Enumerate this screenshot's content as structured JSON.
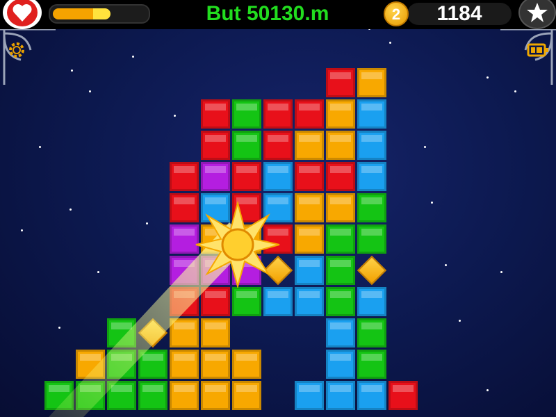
{
  "hud": {
    "goal_text": "But 50130.m",
    "coin_count": "2",
    "score": "1184",
    "energy_fraction": 0.62
  },
  "icons": {
    "lives": "heart-icon",
    "favorite": "star-icon",
    "settings": "gear-icon",
    "battery": "battery-icon",
    "burst": "starburst-icon"
  },
  "colors": {
    "red": "#e8101a",
    "green": "#14c414",
    "blue": "#1aa0f0",
    "orange": "#f8a800",
    "purple": "#b41ee0",
    "goal_text": "#22dd1f"
  },
  "board": {
    "blocks": [
      {
        "c": "red",
        "col": 9,
        "row": 0
      },
      {
        "c": "orange",
        "col": 10,
        "row": 0
      },
      {
        "c": "red",
        "col": 5,
        "row": 1
      },
      {
        "c": "green",
        "col": 6,
        "row": 1
      },
      {
        "c": "red",
        "col": 7,
        "row": 1
      },
      {
        "c": "red",
        "col": 8,
        "row": 1
      },
      {
        "c": "orange",
        "col": 9,
        "row": 1
      },
      {
        "c": "blue",
        "col": 10,
        "row": 1
      },
      {
        "c": "red",
        "col": 5,
        "row": 2
      },
      {
        "c": "green",
        "col": 6,
        "row": 2
      },
      {
        "c": "red",
        "col": 7,
        "row": 2
      },
      {
        "c": "orange",
        "col": 8,
        "row": 2
      },
      {
        "c": "orange",
        "col": 9,
        "row": 2
      },
      {
        "c": "blue",
        "col": 10,
        "row": 2
      },
      {
        "c": "red",
        "col": 4,
        "row": 3
      },
      {
        "c": "purple",
        "col": 5,
        "row": 3
      },
      {
        "c": "red",
        "col": 6,
        "row": 3
      },
      {
        "c": "blue",
        "col": 7,
        "row": 3
      },
      {
        "c": "red",
        "col": 8,
        "row": 3
      },
      {
        "c": "red",
        "col": 9,
        "row": 3
      },
      {
        "c": "blue",
        "col": 10,
        "row": 3
      },
      {
        "c": "red",
        "col": 4,
        "row": 4
      },
      {
        "c": "blue",
        "col": 5,
        "row": 4
      },
      {
        "c": "red",
        "col": 6,
        "row": 4
      },
      {
        "c": "blue",
        "col": 7,
        "row": 4
      },
      {
        "c": "orange",
        "col": 8,
        "row": 4
      },
      {
        "c": "orange",
        "col": 9,
        "row": 4
      },
      {
        "c": "green",
        "col": 10,
        "row": 4
      },
      {
        "c": "purple",
        "col": 4,
        "row": 5
      },
      {
        "c": "orange",
        "col": 5,
        "row": 5
      },
      {
        "c": "orange",
        "col": 6,
        "row": 5
      },
      {
        "c": "red",
        "col": 7,
        "row": 5
      },
      {
        "c": "orange",
        "col": 8,
        "row": 5
      },
      {
        "c": "green",
        "col": 9,
        "row": 5
      },
      {
        "c": "green",
        "col": 10,
        "row": 5
      },
      {
        "c": "purple",
        "col": 4,
        "row": 6
      },
      {
        "c": "purple",
        "col": 5,
        "row": 6
      },
      {
        "c": "purple",
        "col": 6,
        "row": 6
      },
      {
        "c": "blue",
        "col": 8,
        "row": 6
      },
      {
        "c": "green",
        "col": 9,
        "row": 6
      },
      {
        "c": "red",
        "col": 4,
        "row": 7
      },
      {
        "c": "red",
        "col": 5,
        "row": 7
      },
      {
        "c": "green",
        "col": 6,
        "row": 7
      },
      {
        "c": "blue",
        "col": 7,
        "row": 7
      },
      {
        "c": "blue",
        "col": 8,
        "row": 7
      },
      {
        "c": "green",
        "col": 9,
        "row": 7
      },
      {
        "c": "blue",
        "col": 10,
        "row": 7
      },
      {
        "c": "green",
        "col": 2,
        "row": 8
      },
      {
        "c": "orange",
        "col": 4,
        "row": 8
      },
      {
        "c": "orange",
        "col": 5,
        "row": 8
      },
      {
        "c": "blue",
        "col": 9,
        "row": 8
      },
      {
        "c": "green",
        "col": 10,
        "row": 8
      },
      {
        "c": "orange",
        "col": 1,
        "row": 9
      },
      {
        "c": "green",
        "col": 2,
        "row": 9
      },
      {
        "c": "green",
        "col": 3,
        "row": 9
      },
      {
        "c": "orange",
        "col": 4,
        "row": 9
      },
      {
        "c": "orange",
        "col": 5,
        "row": 9
      },
      {
        "c": "orange",
        "col": 6,
        "row": 9
      },
      {
        "c": "blue",
        "col": 9,
        "row": 9
      },
      {
        "c": "green",
        "col": 10,
        "row": 9
      },
      {
        "c": "green",
        "col": 0,
        "row": 10
      },
      {
        "c": "green",
        "col": 1,
        "row": 10
      },
      {
        "c": "green",
        "col": 2,
        "row": 10
      },
      {
        "c": "green",
        "col": 3,
        "row": 10
      },
      {
        "c": "orange",
        "col": 4,
        "row": 10
      },
      {
        "c": "orange",
        "col": 5,
        "row": 10
      },
      {
        "c": "orange",
        "col": 6,
        "row": 10
      },
      {
        "c": "blue",
        "col": 8,
        "row": 10
      },
      {
        "c": "blue",
        "col": 9,
        "row": 10
      },
      {
        "c": "blue",
        "col": 10,
        "row": 10
      },
      {
        "c": "red",
        "col": 11,
        "row": 10
      }
    ],
    "gems": [
      {
        "col": 7,
        "row": 6
      },
      {
        "col": 10,
        "row": 6
      },
      {
        "col": 3,
        "row": 8
      }
    ]
  }
}
